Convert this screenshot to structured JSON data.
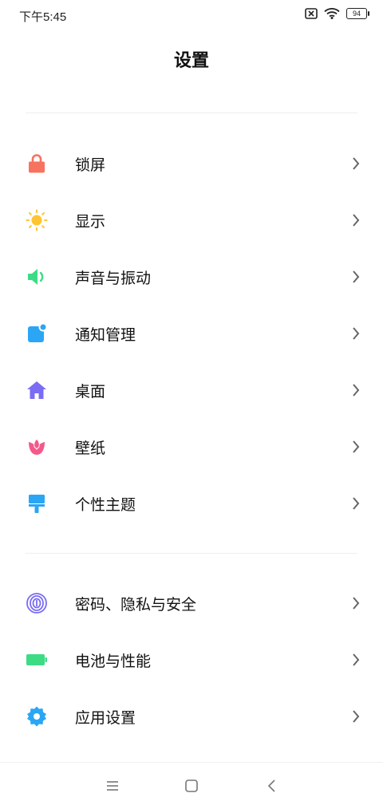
{
  "status_bar": {
    "time": "下午5:45",
    "battery": "94"
  },
  "page": {
    "title": "设置"
  },
  "menu": [
    {
      "label": "锁屏",
      "icon": "lock-icon"
    },
    {
      "label": "显示",
      "icon": "sun-icon"
    },
    {
      "label": "声音与振动",
      "icon": "speaker-icon"
    },
    {
      "label": "通知管理",
      "icon": "notification-icon"
    },
    {
      "label": "桌面",
      "icon": "home-icon"
    },
    {
      "label": "壁纸",
      "icon": "tulip-icon"
    },
    {
      "label": "个性主题",
      "icon": "paint-roller-icon"
    },
    {
      "label": "密码、隐私与安全",
      "icon": "fingerprint-icon"
    },
    {
      "label": "电池与性能",
      "icon": "battery-icon"
    },
    {
      "label": "应用设置",
      "icon": "gear-icon"
    }
  ],
  "colors": {
    "lock": "#f6735f",
    "sun": "#ffc531",
    "speaker": "#3ddc84",
    "notification": "#2aa6f5",
    "home": "#7a6cf5",
    "tulip": "#f35a8a",
    "theme": "#2aa6f5",
    "fingerprint": "#7a6cf5",
    "battery": "#3ddc84",
    "gear": "#2aa6f5"
  }
}
